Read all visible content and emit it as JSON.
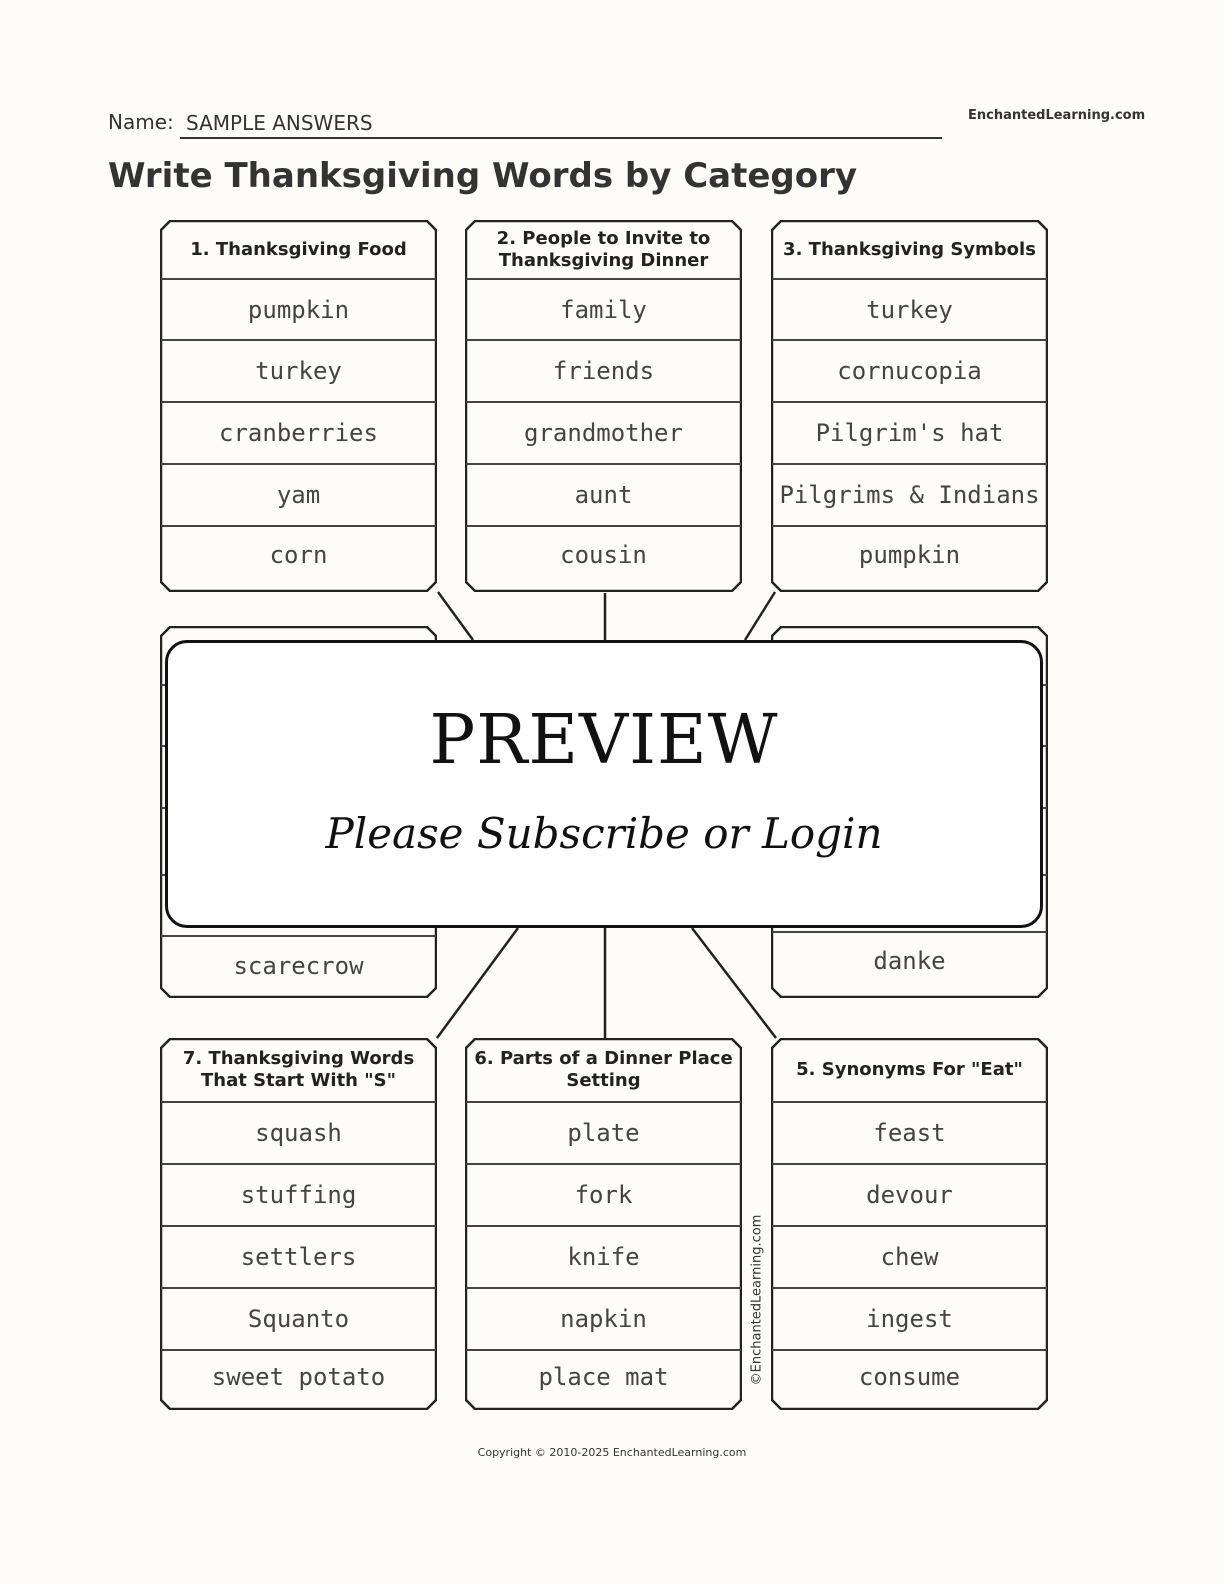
{
  "header": {
    "name_label": "Name:",
    "name_value": "SAMPLE ANSWERS",
    "site_logo": "EnchantedLearning.com",
    "title": "Write Thanksgiving Words by Category"
  },
  "boxes": [
    {
      "id": "1",
      "title": "1. Thanksgiving Food",
      "items": [
        "pumpkin",
        "turkey",
        "cranberries",
        "yam",
        "corn"
      ]
    },
    {
      "id": "2",
      "title": "2.  People to Invite to Thanksgiving Dinner",
      "items": [
        "family",
        "friends",
        "grandmother",
        "aunt",
        "cousin"
      ]
    },
    {
      "id": "3",
      "title": "3. Thanksgiving Symbols",
      "items": [
        "turkey",
        "cornucopia",
        "Pilgrim's hat",
        "Pilgrims & Indians",
        "pumpkin"
      ]
    },
    {
      "id": "8",
      "title": "",
      "items": [
        "",
        "",
        "",
        "",
        "scarecrow"
      ]
    },
    {
      "id": "4",
      "title": "",
      "items": [
        "",
        "",
        "",
        "",
        "danke"
      ]
    },
    {
      "id": "7",
      "title": "7. Thanksgiving Words That Start With \"S\"",
      "items": [
        "squash",
        "stuffing",
        "settlers",
        "Squanto",
        "sweet potato"
      ]
    },
    {
      "id": "6",
      "title": "6. Parts of a Dinner Place Setting",
      "items": [
        "plate",
        "fork",
        "knife",
        "napkin",
        "place mat"
      ]
    },
    {
      "id": "5",
      "title": "5. Synonyms For \"Eat\"",
      "items": [
        "feast",
        "devour",
        "chew",
        "ingest",
        "consume"
      ]
    }
  ],
  "overlay": {
    "title": "PREVIEW",
    "subtitle": "Please Subscribe or Login"
  },
  "vertical_credit": "©EnchantedLearning.com",
  "footer": "Copyright © 2010-2025 EnchantedLearning.com"
}
